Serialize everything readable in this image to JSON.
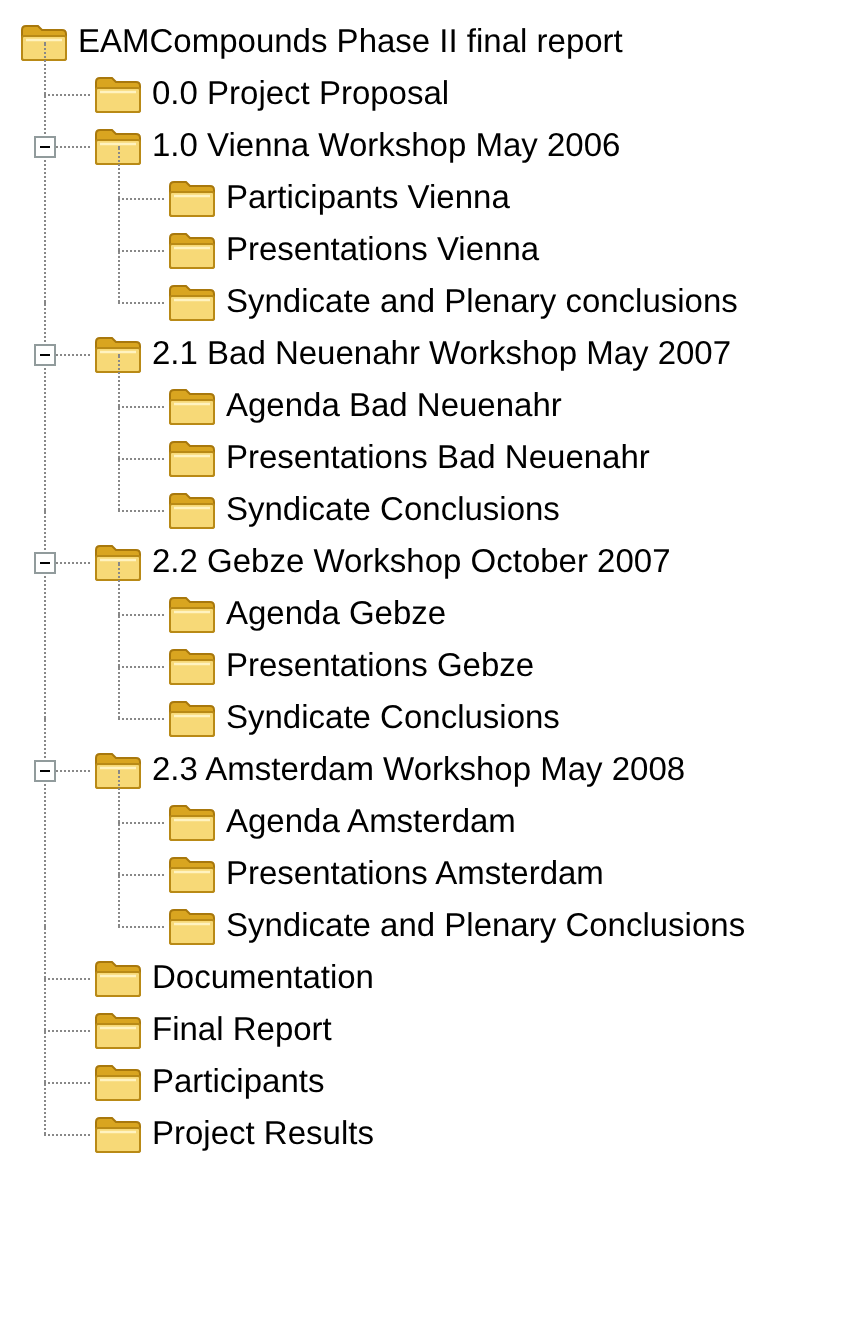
{
  "tree": {
    "label": "EAMCompounds Phase II final report",
    "children": [
      {
        "label": "0.0 Project Proposal"
      },
      {
        "label": "1.0 Vienna Workshop May 2006",
        "expanded": true,
        "children": [
          {
            "label": "Participants Vienna"
          },
          {
            "label": "Presentations Vienna"
          },
          {
            "label": "Syndicate and Plenary conclusions"
          }
        ]
      },
      {
        "label": "2.1 Bad Neuenahr Workshop May 2007",
        "expanded": true,
        "children": [
          {
            "label": "Agenda Bad Neuenahr"
          },
          {
            "label": "Presentations Bad Neuenahr"
          },
          {
            "label": "Syndicate Conclusions"
          }
        ]
      },
      {
        "label": "2.2 Gebze Workshop October 2007",
        "expanded": true,
        "children": [
          {
            "label": "Agenda Gebze"
          },
          {
            "label": "Presentations Gebze"
          },
          {
            "label": "Syndicate Conclusions"
          }
        ]
      },
      {
        "label": "2.3 Amsterdam Workshop May 2008",
        "expanded": true,
        "children": [
          {
            "label": "Agenda Amsterdam"
          },
          {
            "label": "Presentations Amsterdam"
          },
          {
            "label": "Syndicate and Plenary Conclusions"
          }
        ]
      },
      {
        "label": "Documentation"
      },
      {
        "label": "Final Report"
      },
      {
        "label": "Participants"
      },
      {
        "label": "Project Results"
      }
    ]
  }
}
